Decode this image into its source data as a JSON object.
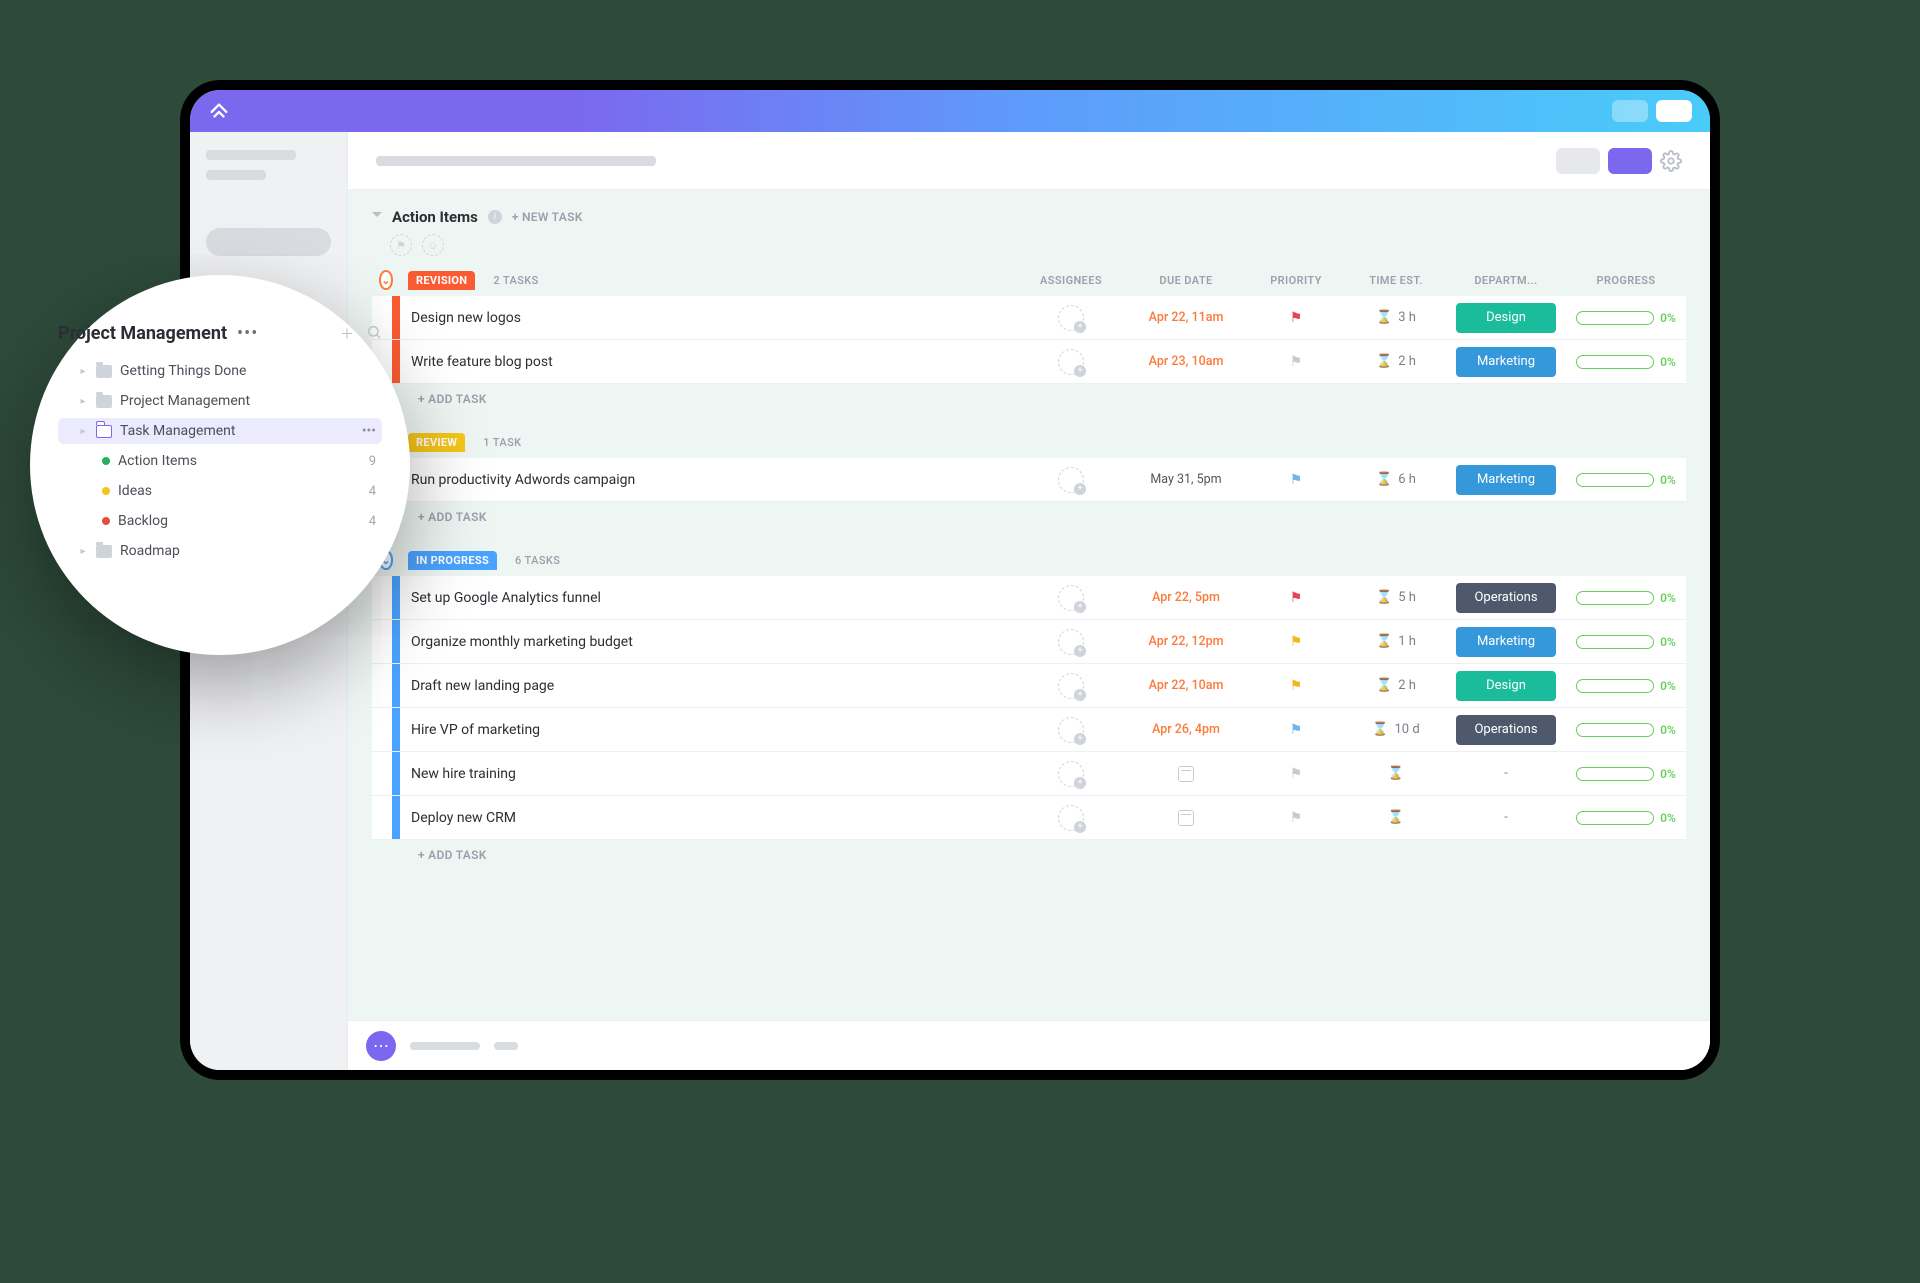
{
  "list": {
    "title": "Action Items",
    "new_task_label": "+ NEW TASK",
    "add_task_label": "+ ADD TASK"
  },
  "columns": {
    "assignees": "ASSIGNEES",
    "due_date": "DUE DATE",
    "priority": "PRIORITY",
    "time_est": "TIME EST.",
    "department": "DEPARTM...",
    "progress": "PROGRESS"
  },
  "statuses": [
    {
      "key": "revision",
      "label": "REVISION",
      "color": "orange",
      "task_count_label": "2 TASKS",
      "tasks": [
        {
          "name": "Design new logos",
          "due": "Apr 22, 11am",
          "due_color": "orange",
          "priority": "red",
          "time": "3 h",
          "dept": "Design",
          "dept_class": "design",
          "progress": "0%"
        },
        {
          "name": "Write feature blog post",
          "due": "Apr 23, 10am",
          "due_color": "orange",
          "priority": "gray",
          "time": "2 h",
          "dept": "Marketing",
          "dept_class": "marketing",
          "progress": "0%"
        }
      ]
    },
    {
      "key": "review",
      "label": "REVIEW",
      "color": "yellow",
      "task_count_label": "1 TASK",
      "tasks": [
        {
          "name": "Run productivity Adwords campaign",
          "due": "May 31, 5pm",
          "due_color": "gray",
          "priority": "blue",
          "time": "6 h",
          "dept": "Marketing",
          "dept_class": "marketing",
          "progress": "0%"
        }
      ]
    },
    {
      "key": "inprogress",
      "label": "IN PROGRESS",
      "color": "blue",
      "task_count_label": "6 TASKS",
      "tasks": [
        {
          "name": "Set up Google Analytics funnel",
          "due": "Apr 22, 5pm",
          "due_color": "orange",
          "priority": "red",
          "time": "5 h",
          "dept": "Operations",
          "dept_class": "operations",
          "progress": "0%"
        },
        {
          "name": "Organize monthly marketing budget",
          "due": "Apr 22, 12pm",
          "due_color": "orange",
          "priority": "yellow",
          "time": "1 h",
          "dept": "Marketing",
          "dept_class": "marketing",
          "progress": "0%"
        },
        {
          "name": "Draft new landing page",
          "due": "Apr 22, 10am",
          "due_color": "orange",
          "priority": "yellow",
          "time": "2 h",
          "dept": "Design",
          "dept_class": "design",
          "progress": "0%"
        },
        {
          "name": "Hire VP of marketing",
          "due": "Apr 26, 4pm",
          "due_color": "orange",
          "priority": "blue",
          "time": "10 d",
          "dept": "Operations",
          "dept_class": "operations",
          "progress": "0%"
        },
        {
          "name": "New hire training",
          "due": "",
          "due_color": "none",
          "priority": "gray",
          "time": "",
          "dept": "-",
          "dept_class": "none",
          "progress": "0%"
        },
        {
          "name": "Deploy new CRM",
          "due": "",
          "due_color": "none",
          "priority": "gray",
          "time": "",
          "dept": "-",
          "dept_class": "none",
          "progress": "0%"
        }
      ]
    }
  ],
  "sidebar": {
    "title": "Project Management",
    "items": [
      {
        "label": "Getting Things Done",
        "level": 2,
        "icon": "folder"
      },
      {
        "label": "Project Management",
        "level": 2,
        "icon": "folder"
      },
      {
        "label": "Task Management",
        "level": 2,
        "icon": "folder-outline",
        "active": true,
        "dots": true
      },
      {
        "label": "Action Items",
        "level": 3,
        "bullet": "green",
        "count": "9"
      },
      {
        "label": "Ideas",
        "level": 3,
        "bullet": "yellow",
        "count": "4"
      },
      {
        "label": "Backlog",
        "level": 3,
        "bullet": "red",
        "count": "4"
      },
      {
        "label": "Roadmap",
        "level": 2,
        "icon": "folder"
      }
    ]
  }
}
